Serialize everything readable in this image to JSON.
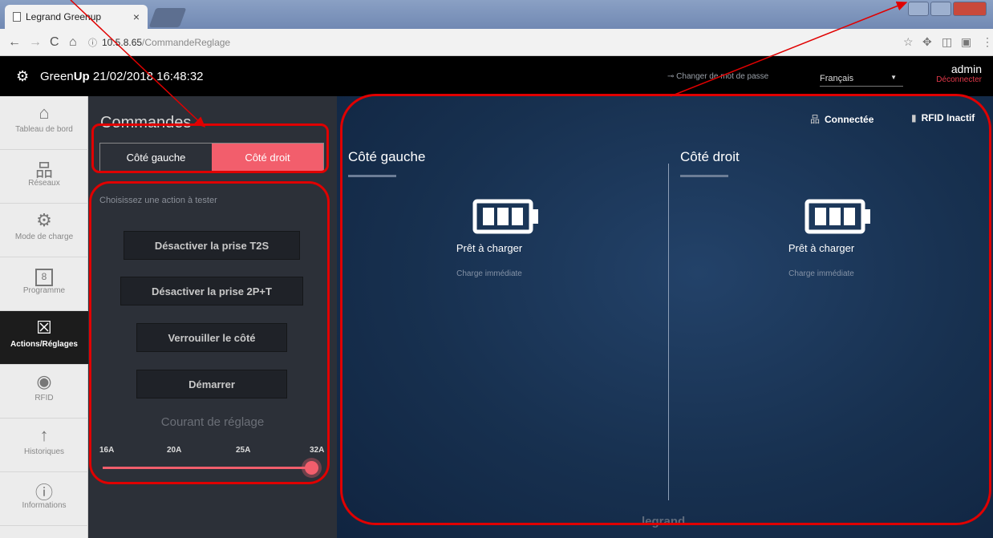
{
  "browser": {
    "tab_title": "Legrand Greenup",
    "tab_close": "×",
    "url_host": "10.5.8.65",
    "url_path": "/CommandeReglage",
    "nav_icons": [
      "back-icon",
      "forward-icon",
      "reload-icon",
      "home-icon"
    ]
  },
  "header": {
    "brand_prefix": "Green",
    "brand_suffix": "Up",
    "datetime": "21/02/2018 16:48:32",
    "change_password": "Changer de mot de passe",
    "language": "Français",
    "user": "admin",
    "logout": "Déconnecter"
  },
  "sidebar": {
    "items": [
      {
        "label": "Tableau de bord",
        "icon": "home-icon",
        "glyph": "⌂"
      },
      {
        "label": "Réseaux",
        "icon": "network-icon",
        "glyph": "品"
      },
      {
        "label": "Mode de charge",
        "icon": "cog-icon",
        "glyph": "⚙"
      },
      {
        "label": "Programme",
        "icon": "calendar-icon",
        "glyph": "8"
      },
      {
        "label": "Actions/Réglages",
        "icon": "monitor-icon",
        "glyph": "☒",
        "active": true
      },
      {
        "label": "RFID",
        "icon": "rfid-icon",
        "glyph": "◉"
      },
      {
        "label": "Historiques",
        "icon": "arrow-up-icon",
        "glyph": "↑"
      },
      {
        "label": "Informations",
        "icon": "info-icon",
        "glyph": "ⓘ"
      }
    ]
  },
  "commands": {
    "title": "Commandes",
    "toggle_left": "Côté gauche",
    "toggle_right": "Côté droit",
    "toggle_selected": "Côté droit",
    "choose_action": "Choisissez une action à tester",
    "actions": [
      "Désactiver la prise T2S",
      "Désactiver la prise 2P+T",
      "Verrouiller le côté",
      "Démarrer"
    ],
    "current_label": "Courant de réglage",
    "current_ticks": [
      "16A",
      "20A",
      "25A",
      "32A"
    ],
    "current_value": "32A"
  },
  "main": {
    "status_connected": "Connectée",
    "status_rfid": "RFID Inactif",
    "left": {
      "title": "Côté gauche",
      "state": "Prêt à charger",
      "mode": "Charge immédiate"
    },
    "right": {
      "title": "Côté droit",
      "state": "Prêt à charger",
      "mode": "Charge immédiate"
    },
    "footer": "legrand"
  },
  "colors": {
    "accent": "#f25e6c",
    "annotation": "#e00000",
    "panel": "#2c3038",
    "main_bg": "#17304f"
  }
}
